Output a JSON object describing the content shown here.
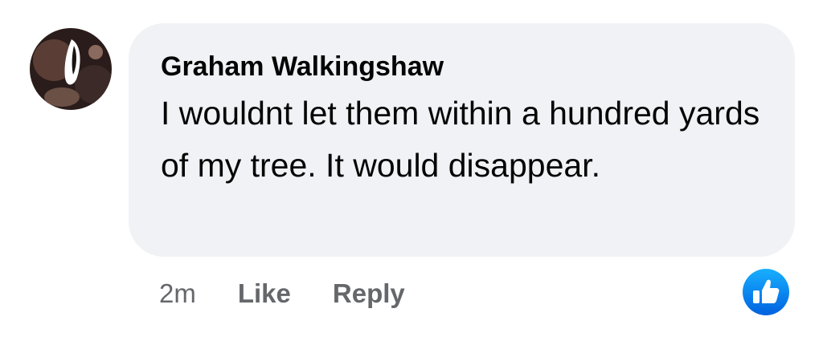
{
  "comment": {
    "author": "Graham Walkingshaw",
    "text": "I wouldnt let them within a hundred yards of my tree. It would disappear."
  },
  "actions": {
    "time": "2m",
    "like_label": "Like",
    "reply_label": "Reply"
  },
  "reaction": {
    "icon": "thumbs-up-icon",
    "color": "#1877f2"
  },
  "colors": {
    "bubble": "#f0f2f5",
    "text": "#050505",
    "secondary": "#65676b"
  }
}
